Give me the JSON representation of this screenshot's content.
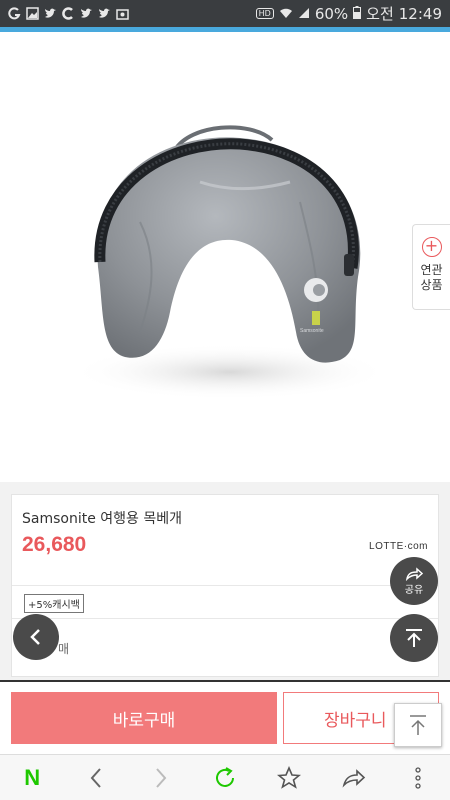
{
  "status_bar": {
    "battery": "60%",
    "time_period": "오전",
    "time": "12:49",
    "hd_badge": "HD"
  },
  "product": {
    "name": "Samsonite 여행용 목베개",
    "price": "26,680",
    "seller": "LOTTE·com",
    "cashback_badge": "+5%캐시백",
    "partial_text": "매",
    "pillow_logo_text": "Samsonite"
  },
  "related_tab": {
    "line1": "연관",
    "line2": "상품"
  },
  "floating": {
    "share_label": "공유"
  },
  "actions": {
    "buy_label": "바로구매",
    "cart_label": "장바구니"
  },
  "browser_nav": {
    "home_label": "N"
  },
  "colors": {
    "accent_red": "#e9595c",
    "buy_button": "#f27a7b",
    "status_bar": "#3a3d40",
    "blue_line": "#49a9dd",
    "naver_green": "#1ec800"
  }
}
